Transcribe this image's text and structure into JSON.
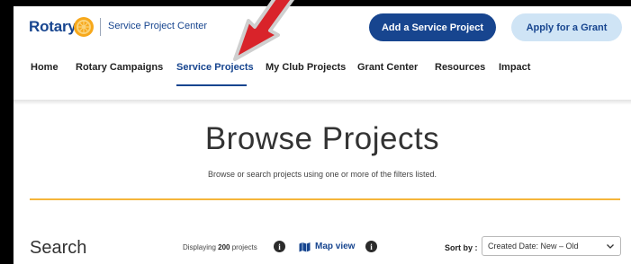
{
  "header": {
    "logo_text": "Rotary",
    "center_name": "Service Project Center",
    "add_button": "Add a Service Project",
    "grant_button": "Apply for a Grant"
  },
  "nav": {
    "items": [
      {
        "label": "Home"
      },
      {
        "label": "Rotary Campaigns"
      },
      {
        "label": "Service Projects",
        "active": true
      },
      {
        "label": "My Club Projects"
      },
      {
        "label": "Grant Center"
      },
      {
        "label": "Resources"
      },
      {
        "label": "Impact"
      }
    ]
  },
  "main": {
    "title": "Browse Projects",
    "subtitle": "Browse or search projects using one or more of the filters listed."
  },
  "search": {
    "heading": "Search",
    "displaying_prefix": "Displaying",
    "count": "200",
    "displaying_suffix": "projects",
    "map_view": "Map view",
    "sort_label": "Sort by :",
    "sort_value": "Created Date: New – Old"
  },
  "colors": {
    "brand_blue": "#17458f",
    "light_blue": "#cfe4f5",
    "gold": "#f5b53b",
    "arrow_red": "#d9232a"
  },
  "icons": [
    "rotary-wheel-icon",
    "info-icon",
    "map-icon",
    "chevron-down-icon",
    "red-arrow-annotation"
  ]
}
